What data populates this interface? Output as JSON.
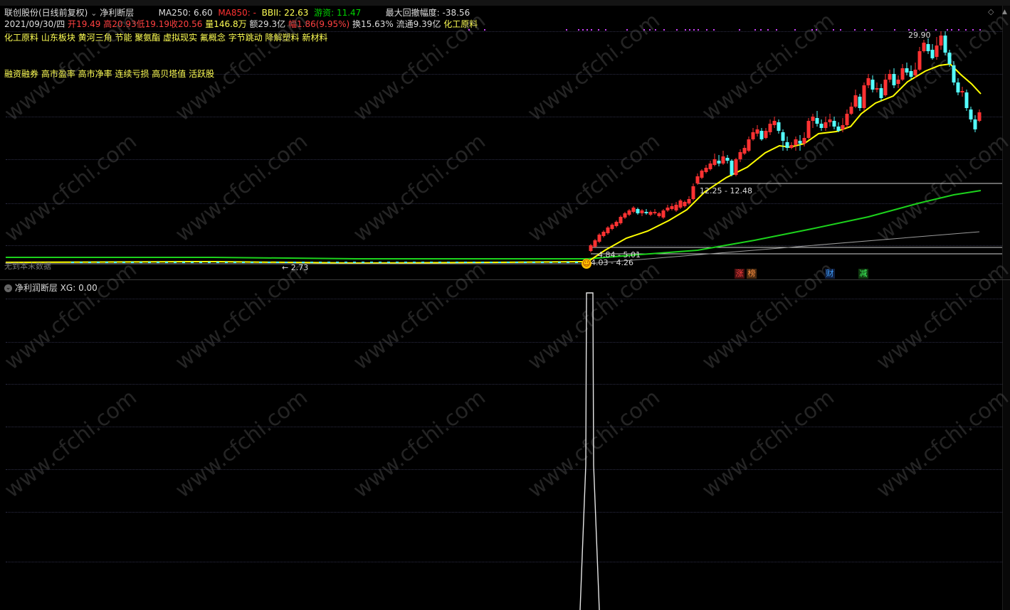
{
  "header": {
    "stock_name": "联创股份(日线前复权)",
    "indicator_name": "净利断层",
    "ma250_label": "MA250:",
    "ma250_value": "6.60",
    "ma850_label": "MA850:",
    "ma850_value": "-",
    "bbi_label": "BBII:",
    "bbi_value": "22.63",
    "youzi_label": "游资:",
    "youzi_value": "11.47",
    "max_drawdown_label": "最大回撤幅度:",
    "max_drawdown_value": "-38.56"
  },
  "quote": {
    "date": "2021/09/30/四",
    "open_label": "开",
    "open": "19.49",
    "high_label": "高",
    "high": "20.93",
    "low_label": "低",
    "low": "19.19",
    "close_label": "收",
    "close": "20.56",
    "volume_label": "量",
    "volume": "146.8万",
    "amount_label": "额",
    "amount": "29.3亿",
    "change_label": "幅",
    "change": "1.86(9.95%)",
    "turnover_label": "换",
    "turnover": "15.63%",
    "float_label": "流通",
    "float_value": "9.39亿",
    "sector": "化工原料"
  },
  "concept_tags_line1": "化工原料 山东板块 黄河三角 节能 聚氨酯 虚拟现实 氟概念 字节跳动 降解塑料 新材料",
  "concept_tags_line2": "融资融券 高市盈率 高市净率 连续亏损 高贝塔值 活跃股",
  "price_labels": {
    "peak": "29.90",
    "band_upper": "12.25 - 12.48",
    "band_mid": "4.84 - 5.01",
    "band_low": "4.03 - 4.26",
    "min_arrow": "← 2.73",
    "no_data": "无到本末数据"
  },
  "event_badges": [
    {
      "text": "涨",
      "color": "#ff4040"
    },
    {
      "text": "榜",
      "color": "#ff9040"
    },
    {
      "text": "财",
      "color": "#40a0ff"
    },
    {
      "text": "减",
      "color": "#40ff60"
    }
  ],
  "indicator_panel": {
    "title": "净利润断层",
    "xg_label": "XG:",
    "xg_value": "0.00"
  },
  "watermark": "www.cfchi.com",
  "colors": {
    "up_candle": "#ff3232",
    "down_candle": "#54ffff",
    "ma_yellow": "#ffff00",
    "ma_green": "#1cd21c",
    "ma_white": "#9a9a9a"
  },
  "chart_data": {
    "type": "candlestick",
    "series": [
      {
        "name": "MA250",
        "value": "6.60"
      },
      {
        "name": "BBII",
        "value": "22.63"
      }
    ],
    "peak_value": 29.9,
    "min_value": 2.73,
    "indicator_xg": 0.0
  }
}
